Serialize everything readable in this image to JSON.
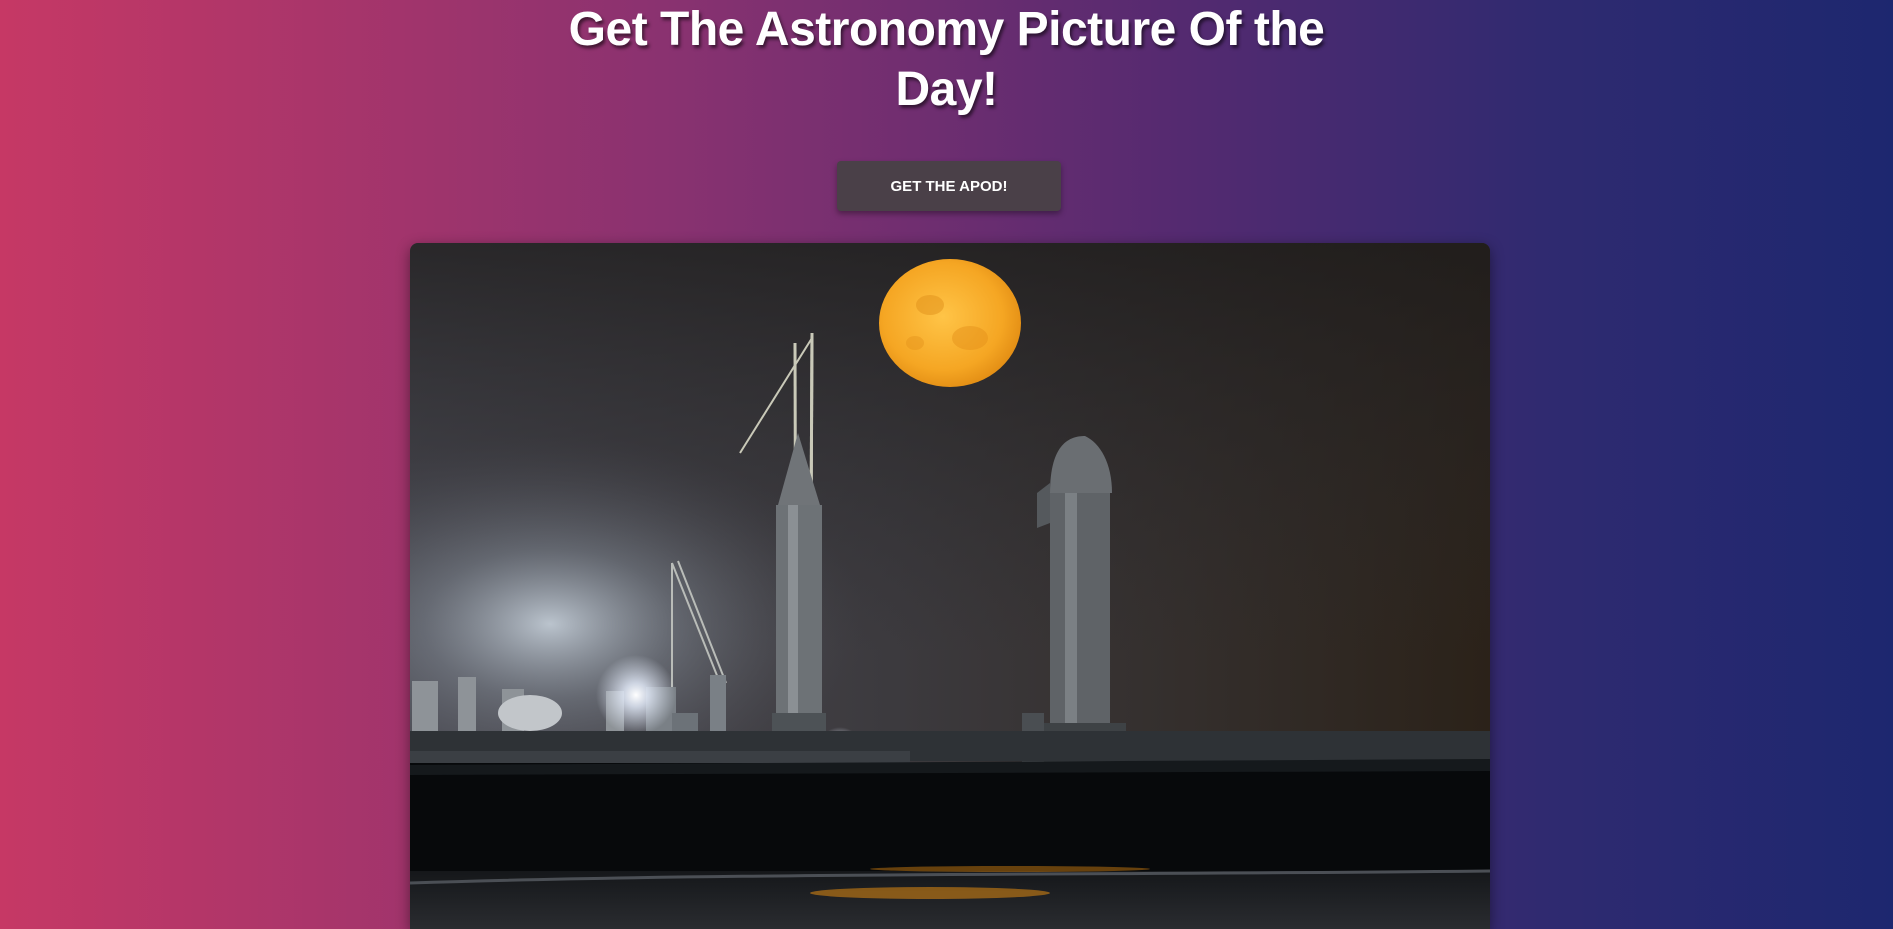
{
  "header": {
    "title": "Get The Astronomy Picture Of the Day!"
  },
  "actions": {
    "get_apod_label": "GET THE APOD!"
  },
  "colors": {
    "gradient_left": "#c63865",
    "gradient_right": "#1d276f",
    "button_bg": "#4a4048",
    "moon": "#f5a623"
  }
}
